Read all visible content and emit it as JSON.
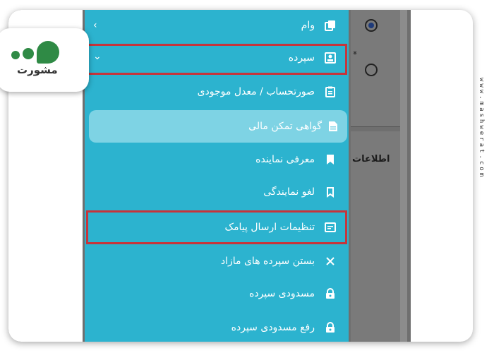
{
  "menu": {
    "items": [
      {
        "label": "وام",
        "icon": "copy-icon",
        "chevron": "‹"
      },
      {
        "label": "سپرده",
        "icon": "portrait-icon",
        "chevron": "⌄"
      },
      {
        "label": "صورتحساب / معدل موجودی",
        "icon": "clipboard-icon"
      },
      {
        "label": "گواهی تمکن مالی",
        "icon": "document-icon"
      },
      {
        "label": "معرفی نماینده",
        "icon": "bookmark-filled-icon"
      },
      {
        "label": "لغو نمایندگی",
        "icon": "bookmark-outline-icon"
      },
      {
        "label": "تنظیمات ارسال پیامک",
        "icon": "message-icon"
      },
      {
        "label": "بستن سپرده های مازاد",
        "icon": "close-icon"
      },
      {
        "label": "مسدودی سپرده",
        "icon": "lock-icon"
      },
      {
        "label": "رفع مسدودی سپرده",
        "icon": "unlock-icon"
      }
    ]
  },
  "background": {
    "side_label": "اطلاعات",
    "asterisk": "*"
  },
  "logo": {
    "text": "مشورت"
  },
  "watermark": {
    "text": "www.mashwerat.com"
  },
  "colors": {
    "menu_bg": "#2cb3cf",
    "active_bg": "#7ed3e4",
    "highlight": "#c6343b",
    "logo_green": "#2f8a45"
  }
}
